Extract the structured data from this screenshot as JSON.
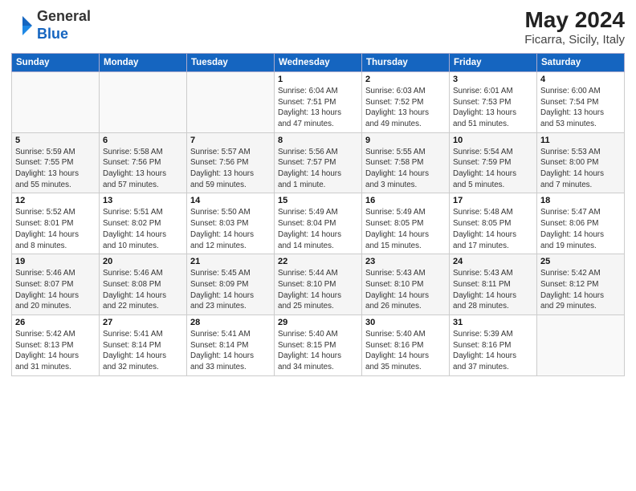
{
  "header": {
    "logo_general": "General",
    "logo_blue": "Blue",
    "month_year": "May 2024",
    "location": "Ficarra, Sicily, Italy"
  },
  "columns": [
    "Sunday",
    "Monday",
    "Tuesday",
    "Wednesday",
    "Thursday",
    "Friday",
    "Saturday"
  ],
  "weeks": [
    [
      {
        "day": "",
        "info": ""
      },
      {
        "day": "",
        "info": ""
      },
      {
        "day": "",
        "info": ""
      },
      {
        "day": "1",
        "info": "Sunrise: 6:04 AM\nSunset: 7:51 PM\nDaylight: 13 hours\nand 47 minutes."
      },
      {
        "day": "2",
        "info": "Sunrise: 6:03 AM\nSunset: 7:52 PM\nDaylight: 13 hours\nand 49 minutes."
      },
      {
        "day": "3",
        "info": "Sunrise: 6:01 AM\nSunset: 7:53 PM\nDaylight: 13 hours\nand 51 minutes."
      },
      {
        "day": "4",
        "info": "Sunrise: 6:00 AM\nSunset: 7:54 PM\nDaylight: 13 hours\nand 53 minutes."
      }
    ],
    [
      {
        "day": "5",
        "info": "Sunrise: 5:59 AM\nSunset: 7:55 PM\nDaylight: 13 hours\nand 55 minutes."
      },
      {
        "day": "6",
        "info": "Sunrise: 5:58 AM\nSunset: 7:56 PM\nDaylight: 13 hours\nand 57 minutes."
      },
      {
        "day": "7",
        "info": "Sunrise: 5:57 AM\nSunset: 7:56 PM\nDaylight: 13 hours\nand 59 minutes."
      },
      {
        "day": "8",
        "info": "Sunrise: 5:56 AM\nSunset: 7:57 PM\nDaylight: 14 hours\nand 1 minute."
      },
      {
        "day": "9",
        "info": "Sunrise: 5:55 AM\nSunset: 7:58 PM\nDaylight: 14 hours\nand 3 minutes."
      },
      {
        "day": "10",
        "info": "Sunrise: 5:54 AM\nSunset: 7:59 PM\nDaylight: 14 hours\nand 5 minutes."
      },
      {
        "day": "11",
        "info": "Sunrise: 5:53 AM\nSunset: 8:00 PM\nDaylight: 14 hours\nand 7 minutes."
      }
    ],
    [
      {
        "day": "12",
        "info": "Sunrise: 5:52 AM\nSunset: 8:01 PM\nDaylight: 14 hours\nand 8 minutes."
      },
      {
        "day": "13",
        "info": "Sunrise: 5:51 AM\nSunset: 8:02 PM\nDaylight: 14 hours\nand 10 minutes."
      },
      {
        "day": "14",
        "info": "Sunrise: 5:50 AM\nSunset: 8:03 PM\nDaylight: 14 hours\nand 12 minutes."
      },
      {
        "day": "15",
        "info": "Sunrise: 5:49 AM\nSunset: 8:04 PM\nDaylight: 14 hours\nand 14 minutes."
      },
      {
        "day": "16",
        "info": "Sunrise: 5:49 AM\nSunset: 8:05 PM\nDaylight: 14 hours\nand 15 minutes."
      },
      {
        "day": "17",
        "info": "Sunrise: 5:48 AM\nSunset: 8:05 PM\nDaylight: 14 hours\nand 17 minutes."
      },
      {
        "day": "18",
        "info": "Sunrise: 5:47 AM\nSunset: 8:06 PM\nDaylight: 14 hours\nand 19 minutes."
      }
    ],
    [
      {
        "day": "19",
        "info": "Sunrise: 5:46 AM\nSunset: 8:07 PM\nDaylight: 14 hours\nand 20 minutes."
      },
      {
        "day": "20",
        "info": "Sunrise: 5:46 AM\nSunset: 8:08 PM\nDaylight: 14 hours\nand 22 minutes."
      },
      {
        "day": "21",
        "info": "Sunrise: 5:45 AM\nSunset: 8:09 PM\nDaylight: 14 hours\nand 23 minutes."
      },
      {
        "day": "22",
        "info": "Sunrise: 5:44 AM\nSunset: 8:10 PM\nDaylight: 14 hours\nand 25 minutes."
      },
      {
        "day": "23",
        "info": "Sunrise: 5:43 AM\nSunset: 8:10 PM\nDaylight: 14 hours\nand 26 minutes."
      },
      {
        "day": "24",
        "info": "Sunrise: 5:43 AM\nSunset: 8:11 PM\nDaylight: 14 hours\nand 28 minutes."
      },
      {
        "day": "25",
        "info": "Sunrise: 5:42 AM\nSunset: 8:12 PM\nDaylight: 14 hours\nand 29 minutes."
      }
    ],
    [
      {
        "day": "26",
        "info": "Sunrise: 5:42 AM\nSunset: 8:13 PM\nDaylight: 14 hours\nand 31 minutes."
      },
      {
        "day": "27",
        "info": "Sunrise: 5:41 AM\nSunset: 8:14 PM\nDaylight: 14 hours\nand 32 minutes."
      },
      {
        "day": "28",
        "info": "Sunrise: 5:41 AM\nSunset: 8:14 PM\nDaylight: 14 hours\nand 33 minutes."
      },
      {
        "day": "29",
        "info": "Sunrise: 5:40 AM\nSunset: 8:15 PM\nDaylight: 14 hours\nand 34 minutes."
      },
      {
        "day": "30",
        "info": "Sunrise: 5:40 AM\nSunset: 8:16 PM\nDaylight: 14 hours\nand 35 minutes."
      },
      {
        "day": "31",
        "info": "Sunrise: 5:39 AM\nSunset: 8:16 PM\nDaylight: 14 hours\nand 37 minutes."
      },
      {
        "day": "",
        "info": ""
      }
    ]
  ]
}
